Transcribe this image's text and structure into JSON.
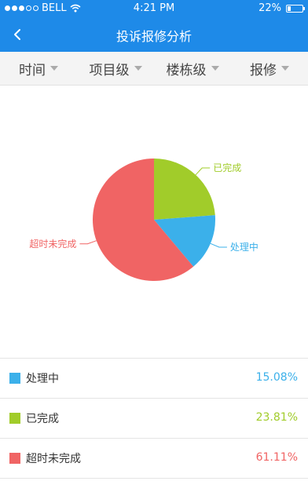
{
  "status": {
    "carrier": "BELL",
    "time": "4:21 PM",
    "battery": "22%",
    "battery_level": 0.22
  },
  "nav": {
    "title": "投诉报修分析"
  },
  "filters": [
    {
      "label": "时间"
    },
    {
      "label": "项目级"
    },
    {
      "label": "楼栋级"
    },
    {
      "label": "报修"
    }
  ],
  "chart_data": {
    "type": "pie",
    "slices": [
      {
        "label": "已完成",
        "value": 23.81,
        "color": "#a1cc2a"
      },
      {
        "label": "处理中",
        "value": 15.08,
        "color": "#3bb0ea"
      },
      {
        "label": "超时未完成",
        "value": 61.11,
        "color": "#f06464"
      }
    ]
  },
  "legend": [
    {
      "label": "处理中",
      "value": "15.08%",
      "color": "#3bb0ea"
    },
    {
      "label": "已完成",
      "value": "23.81%",
      "color": "#a1cc2a"
    },
    {
      "label": "超时未完成",
      "value": "61.11%",
      "color": "#f06464"
    }
  ]
}
